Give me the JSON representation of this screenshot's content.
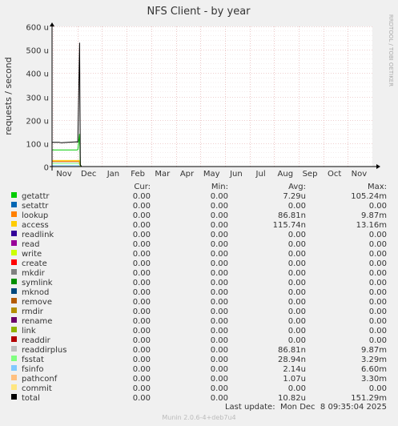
{
  "chart_data": {
    "type": "line",
    "title": "NFS Client - by year",
    "ylabel": "requests / second",
    "side_label": "RRDTOOL / TOBI OETIKER",
    "ylim": [
      0,
      600
    ],
    "y_ticks": [
      {
        "value": 0,
        "label": "0"
      },
      {
        "value": 100,
        "label": "100 u"
      },
      {
        "value": 200,
        "label": "200 u"
      },
      {
        "value": 300,
        "label": "300 u"
      },
      {
        "value": 400,
        "label": "400 u"
      },
      {
        "value": 500,
        "label": "500 u"
      },
      {
        "value": 600,
        "label": "600 u"
      }
    ],
    "x_labels": [
      "Nov",
      "Dec",
      "Jan",
      "Feb",
      "Mar",
      "Apr",
      "May",
      "Jun",
      "Jul",
      "Aug",
      "Sep",
      "Oct",
      "Nov"
    ],
    "series": [
      {
        "name": "total",
        "color": "#000000",
        "points": [
          [
            0,
            104
          ],
          [
            0.3,
            104
          ],
          [
            0.36,
            102
          ],
          [
            1.0,
            106
          ],
          [
            1.05,
            105
          ],
          [
            1.12,
            530
          ],
          [
            1.15,
            8
          ],
          [
            1.2,
            0
          ]
        ]
      },
      {
        "name": "getattr",
        "color": "#00cc00",
        "points": [
          [
            0,
            71
          ],
          [
            1.0,
            71
          ],
          [
            1.05,
            72
          ],
          [
            1.12,
            140
          ],
          [
            1.15,
            6
          ],
          [
            1.2,
            0
          ]
        ]
      },
      {
        "name": "access",
        "color": "#ffcc00",
        "points": [
          [
            0,
            26
          ],
          [
            1.1,
            26
          ],
          [
            1.15,
            3
          ],
          [
            1.2,
            0
          ]
        ]
      },
      {
        "name": "lookup",
        "color": "#ff8000",
        "points": [
          [
            0,
            22
          ],
          [
            1.1,
            22
          ],
          [
            1.15,
            3
          ],
          [
            1.2,
            0
          ]
        ]
      },
      {
        "name": "readdirplus",
        "color": "#b0b0b0",
        "points": [
          [
            0,
            20
          ],
          [
            1.1,
            20
          ],
          [
            1.15,
            3
          ],
          [
            1.2,
            0
          ]
        ]
      },
      {
        "name": "fsstat",
        "color": "#80ff80",
        "points": [
          [
            0,
            13
          ],
          [
            1.1,
            13
          ],
          [
            1.15,
            2
          ],
          [
            1.2,
            0
          ]
        ]
      },
      {
        "name": "fsinfo",
        "color": "#80c9ff",
        "points": [
          [
            0,
            4
          ],
          [
            1.1,
            4
          ],
          [
            1.15,
            1
          ],
          [
            1.2,
            0
          ]
        ]
      }
    ]
  },
  "legend": {
    "headers": [
      "Cur:",
      "Min:",
      "Avg:",
      "Max:"
    ],
    "rows": [
      {
        "name": "getattr",
        "color": "#00cc00",
        "cur": "0.00",
        "min": "0.00",
        "avg": "7.29u",
        "max": "105.24m"
      },
      {
        "name": "setattr",
        "color": "#0066b3",
        "cur": "0.00",
        "min": "0.00",
        "avg": "0.00",
        "max": "0.00"
      },
      {
        "name": "lookup",
        "color": "#ff8000",
        "cur": "0.00",
        "min": "0.00",
        "avg": "86.81n",
        "max": "9.87m"
      },
      {
        "name": "access",
        "color": "#ffcc00",
        "cur": "0.00",
        "min": "0.00",
        "avg": "115.74n",
        "max": "13.16m"
      },
      {
        "name": "readlink",
        "color": "#330099",
        "cur": "0.00",
        "min": "0.00",
        "avg": "0.00",
        "max": "0.00"
      },
      {
        "name": "read",
        "color": "#990099",
        "cur": "0.00",
        "min": "0.00",
        "avg": "0.00",
        "max": "0.00"
      },
      {
        "name": "write",
        "color": "#ccff00",
        "cur": "0.00",
        "min": "0.00",
        "avg": "0.00",
        "max": "0.00"
      },
      {
        "name": "create",
        "color": "#ff0000",
        "cur": "0.00",
        "min": "0.00",
        "avg": "0.00",
        "max": "0.00"
      },
      {
        "name": "mkdir",
        "color": "#808080",
        "cur": "0.00",
        "min": "0.00",
        "avg": "0.00",
        "max": "0.00"
      },
      {
        "name": "symlink",
        "color": "#008f00",
        "cur": "0.00",
        "min": "0.00",
        "avg": "0.00",
        "max": "0.00"
      },
      {
        "name": "mknod",
        "color": "#00487d",
        "cur": "0.00",
        "min": "0.00",
        "avg": "0.00",
        "max": "0.00"
      },
      {
        "name": "remove",
        "color": "#b35a00",
        "cur": "0.00",
        "min": "0.00",
        "avg": "0.00",
        "max": "0.00"
      },
      {
        "name": "rmdir",
        "color": "#b38f00",
        "cur": "0.00",
        "min": "0.00",
        "avg": "0.00",
        "max": "0.00"
      },
      {
        "name": "rename",
        "color": "#6b006b",
        "cur": "0.00",
        "min": "0.00",
        "avg": "0.00",
        "max": "0.00"
      },
      {
        "name": "link",
        "color": "#8fb300",
        "cur": "0.00",
        "min": "0.00",
        "avg": "0.00",
        "max": "0.00"
      },
      {
        "name": "readdir",
        "color": "#b30000",
        "cur": "0.00",
        "min": "0.00",
        "avg": "0.00",
        "max": "0.00"
      },
      {
        "name": "readdirplus",
        "color": "#bebebe",
        "cur": "0.00",
        "min": "0.00",
        "avg": "86.81n",
        "max": "9.87m"
      },
      {
        "name": "fsstat",
        "color": "#80ff80",
        "cur": "0.00",
        "min": "0.00",
        "avg": "28.94n",
        "max": "3.29m"
      },
      {
        "name": "fsinfo",
        "color": "#80c9ff",
        "cur": "0.00",
        "min": "0.00",
        "avg": "2.14u",
        "max": "6.60m"
      },
      {
        "name": "pathconf",
        "color": "#ffc080",
        "cur": "0.00",
        "min": "0.00",
        "avg": "1.07u",
        "max": "3.30m"
      },
      {
        "name": "commit",
        "color": "#ffe680",
        "cur": "0.00",
        "min": "0.00",
        "avg": "0.00",
        "max": "0.00"
      },
      {
        "name": "total",
        "color": "#000000",
        "cur": "0.00",
        "min": "0.00",
        "avg": "10.82u",
        "max": "151.29m"
      }
    ]
  },
  "last_update": "Last update:  Mon Dec  8 09:35:04 2025",
  "footer": "Munin 2.0.6-4+deb7u4"
}
